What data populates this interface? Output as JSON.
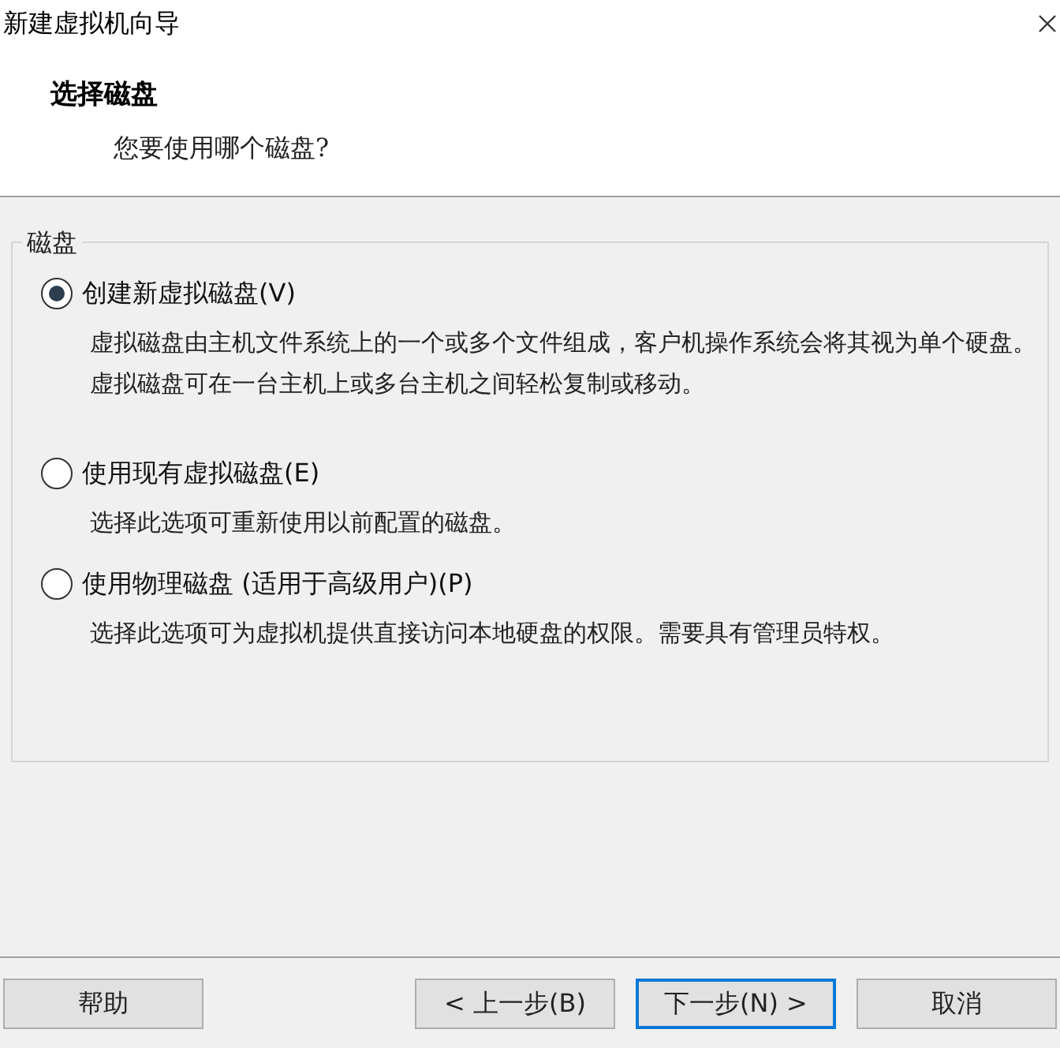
{
  "window": {
    "title": "新建虚拟机向导"
  },
  "header": {
    "title": "选择磁盘",
    "subtitle": "您要使用哪个磁盘?"
  },
  "group": {
    "label": "磁盘",
    "options": [
      {
        "label": "创建新虚拟磁盘(V)",
        "description": "虚拟磁盘由主机文件系统上的一个或多个文件组成，客户机操作系统会将其视为单个硬盘。虚拟磁盘可在一台主机上或多台主机之间轻松复制或移动。",
        "selected": true
      },
      {
        "label": "使用现有虚拟磁盘(E)",
        "description": "选择此选项可重新使用以前配置的磁盘。",
        "selected": false
      },
      {
        "label": "使用物理磁盘 (适用于高级用户)(P)",
        "description": "选择此选项可为虚拟机提供直接访问本地硬盘的权限。需要具有管理员特权。",
        "selected": false
      }
    ]
  },
  "buttons": [
    {
      "label": "帮助",
      "kind": "left",
      "default": false
    },
    {
      "label": "< 上一步(B)",
      "kind": "right",
      "default": false
    },
    {
      "label": "下一步(N) >",
      "kind": "right",
      "default": true
    },
    {
      "label": "取消",
      "kind": "right",
      "default": false
    }
  ]
}
